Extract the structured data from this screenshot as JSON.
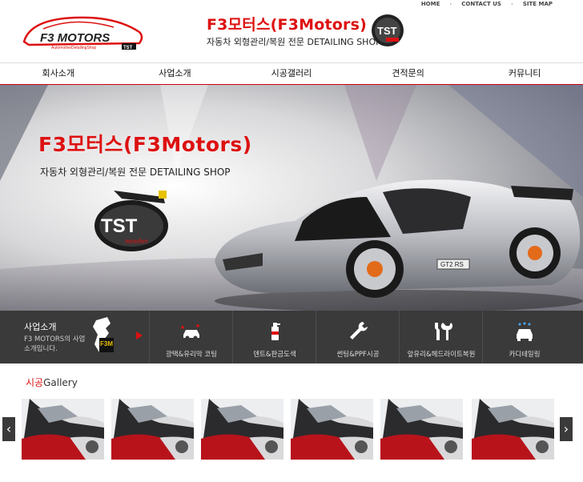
{
  "util_nav": [
    "HOME",
    "CONTACT US",
    "SITE MAP"
  ],
  "header": {
    "logo_text": "F3 MOTORS",
    "logo_sub": "AutomotiveDetailingShop",
    "logo_tst": "TST",
    "title": "F3모터스(F3Motors)",
    "subtitle": "자동차 외형관리/복원 전문 DETAILING SHOP",
    "badge_text": "TST"
  },
  "nav": [
    "회사소개",
    "사업소개",
    "시공갤러리",
    "견적문의",
    "커뮤니티"
  ],
  "hero": {
    "title": "F3모터스(F3Motors)",
    "subtitle": "자동차 외형관리/복원 전문 DETAILING SHOP",
    "badge_text": "TST",
    "badge_sub": "member",
    "car_plate": "GT2 RS"
  },
  "business": {
    "title": "사업소개",
    "desc": "F3 MOTORS의 사업소개입니다.",
    "map_label": "F3M",
    "items": [
      {
        "label": "광택&유리막 코팅",
        "icon": "car-polish-icon"
      },
      {
        "label": "덴트&판금도색",
        "icon": "spray-can-icon"
      },
      {
        "label": "썬팅&PPF시공",
        "icon": "wrench-icon"
      },
      {
        "label": "앞유리&헤드라이트복원",
        "icon": "tools-icon"
      },
      {
        "label": "카디테일링",
        "icon": "car-wash-icon"
      }
    ]
  },
  "gallery": {
    "title_red": "시공",
    "title_rest": "Gallery",
    "prev": "‹",
    "next": "›",
    "thumb_count": 6
  },
  "colors": {
    "accent": "#dd1111",
    "dark_bar": "#3a3a3a"
  }
}
